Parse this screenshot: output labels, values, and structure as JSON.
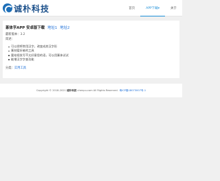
{
  "header": {
    "logo_text": "诚朴科技",
    "nav": [
      {
        "label": "首页"
      },
      {
        "label": "APP下载▾"
      },
      {
        "label": "关于"
      }
    ],
    "active_index": 1,
    "colors": {
      "accent": "#1d8fd8",
      "logo": "#1a4f8a"
    }
  },
  "article": {
    "title": "篆体字APP 安卓版下载",
    "link1": "地址1",
    "link2": "地址2",
    "version": "最新版本：3.2",
    "intro": "简述：",
    "features": [
      "可以把将常用汉字，改变成其汉字形",
      "篆刻爱好者的工具",
      "要给视发写不太好意思的语，可以用篆体试试",
      "能增汉字字查功能"
    ],
    "category_label": "分类：",
    "category_link": "实用工具"
  },
  "footer": {
    "prefix": "Copyright © 2018-2021",
    "brand": "诚朴科技",
    "suffix": "chenpu.com All Rights Reserved.",
    "icp": "粤ICP备18073007号-1"
  }
}
